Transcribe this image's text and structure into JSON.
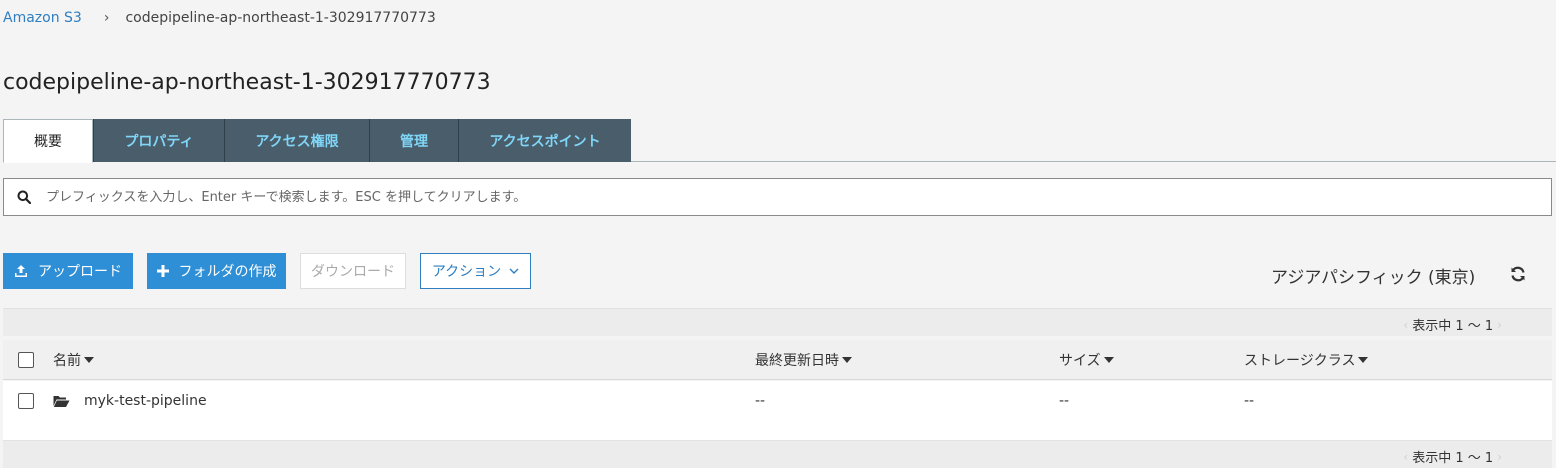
{
  "breadcrumb": {
    "root": "Amazon S3",
    "separator": "›",
    "current": "codepipeline-ap-northeast-1-302917770773"
  },
  "page_title": "codepipeline-ap-northeast-1-302917770773",
  "tabs": [
    {
      "label": "概要",
      "active": true
    },
    {
      "label": "プロパティ",
      "active": false
    },
    {
      "label": "アクセス権限",
      "active": false
    },
    {
      "label": "管理",
      "active": false
    },
    {
      "label": "アクセスポイント",
      "active": false
    }
  ],
  "search": {
    "placeholder": "プレフィックスを入力し、Enter キーで検索します。ESC を押してクリアします。",
    "value": ""
  },
  "toolbar": {
    "upload_label": "アップロード",
    "create_folder_label": "フォルダの作成",
    "download_label": "ダウンロード",
    "actions_label": "アクション"
  },
  "region": "アジアパシフィック (東京)",
  "pager": {
    "text": "表示中 1 ～ 1"
  },
  "table": {
    "columns": [
      "名前",
      "最終更新日時",
      "サイズ",
      "ストレージクラス"
    ],
    "rows": [
      {
        "name": "myk-test-pipeline",
        "type": "folder",
        "last_modified": "--",
        "size": "--",
        "storage_class": "--"
      }
    ]
  },
  "colors": {
    "accent": "#2e8fd6",
    "tab_bg": "#4a5d6b",
    "tab_text": "#7fd6f7",
    "link": "#2e7ec0"
  }
}
